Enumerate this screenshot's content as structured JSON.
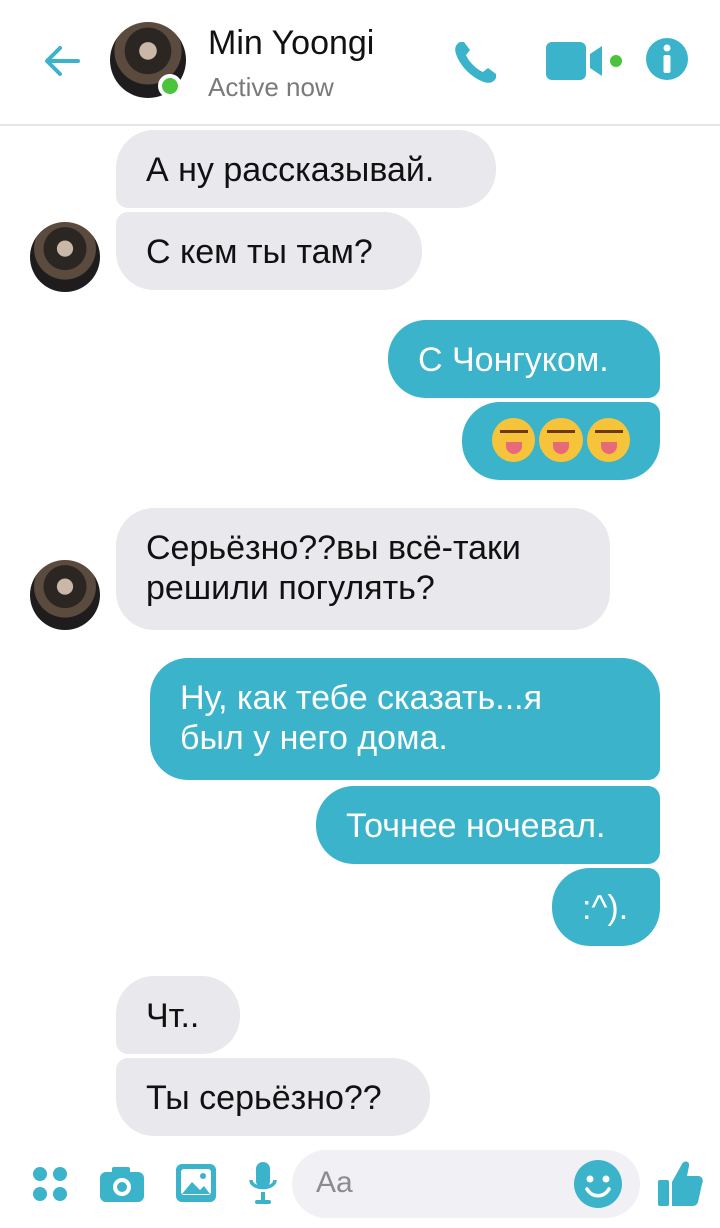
{
  "header": {
    "contact_name": "Min Yoongi",
    "status": "Active now",
    "icons": [
      "back-arrow-icon",
      "phone-icon",
      "video-icon",
      "info-icon"
    ],
    "accent_color": "#3bb3cb"
  },
  "messages": [
    {
      "side": "incoming",
      "text": "А ну рассказывай."
    },
    {
      "side": "incoming",
      "text": "С кем ты там?"
    },
    {
      "side": "outgoing",
      "text": "С Чонгуком."
    },
    {
      "side": "outgoing",
      "text": "😝😝😝"
    },
    {
      "side": "incoming",
      "lines": [
        "Серьёзно??вы всё-таки",
        "решили погулять?"
      ]
    },
    {
      "side": "outgoing",
      "lines": [
        "Ну, как тебе сказать...я",
        "был у него дома."
      ]
    },
    {
      "side": "outgoing",
      "text": "Точнее ночевал."
    },
    {
      "side": "outgoing",
      "text": ":^)."
    },
    {
      "side": "incoming",
      "text": "Чт.."
    },
    {
      "side": "incoming",
      "text": "Ты серьёзно??"
    }
  ],
  "composer": {
    "placeholder": "Aa",
    "icons": [
      "apps-icon",
      "camera-icon",
      "gallery-icon",
      "microphone-icon",
      "smile-icon",
      "thumbs-up-icon"
    ]
  }
}
